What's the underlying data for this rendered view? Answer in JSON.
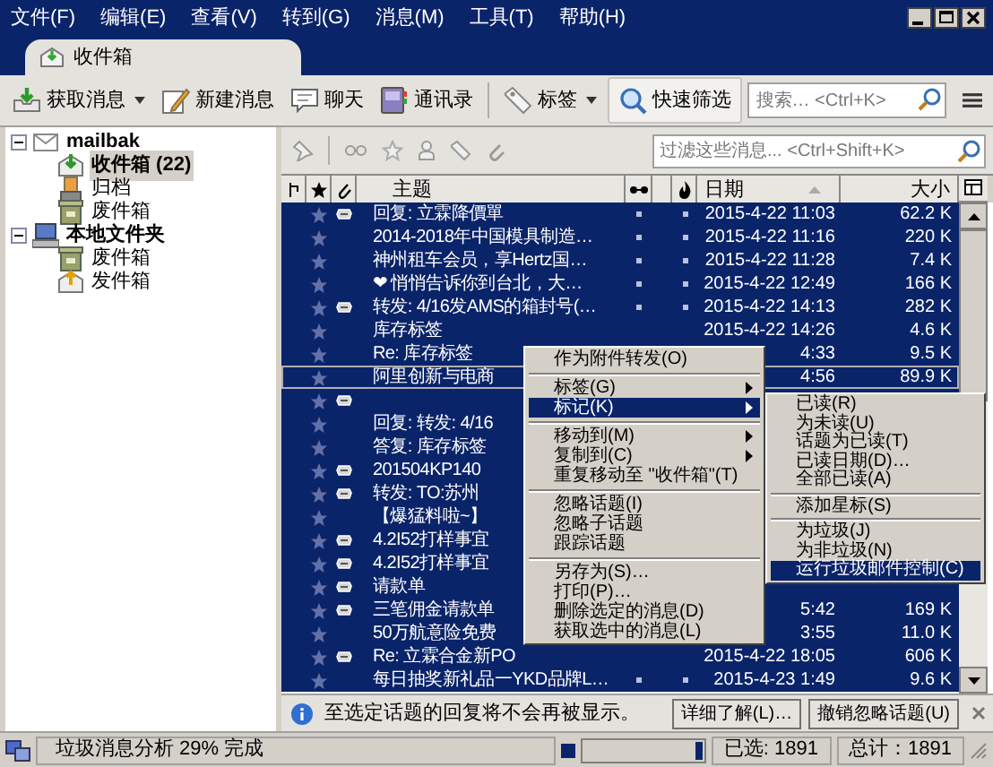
{
  "menu_bar": [
    "文件(F)",
    "编辑(E)",
    "查看(V)",
    "转到(G)",
    "消息(M)",
    "工具(T)",
    "帮助(H)"
  ],
  "tabs": [
    {
      "label": "收件箱",
      "selected": true
    }
  ],
  "toolbar": {
    "buttons": [
      {
        "label": "获取消息",
        "kind": "get",
        "dropdown": true,
        "pressed": false
      },
      {
        "label": "新建消息",
        "kind": "write",
        "dropdown": false,
        "pressed": false
      },
      {
        "label": "聊天",
        "kind": "chat",
        "dropdown": false,
        "pressed": false
      },
      {
        "label": "通讯录",
        "kind": "book",
        "dropdown": false,
        "pressed": false
      },
      {
        "label": "标签",
        "kind": "tag",
        "dropdown": true,
        "pressed": false
      },
      {
        "label": "快速筛选",
        "kind": "filter",
        "dropdown": false,
        "pressed": true
      }
    ],
    "search": {
      "placeholder": "搜索… <Ctrl+K>"
    }
  },
  "folders": [
    {
      "name": "mailbak",
      "kind": "account",
      "expanded": true,
      "selected": false,
      "children": [
        {
          "name": "收件箱",
          "count": "(22)",
          "kind": "inbox",
          "selected": true
        },
        {
          "name": "归档",
          "kind": "archive",
          "selected": false
        },
        {
          "name": "废件箱",
          "kind": "trash",
          "selected": false
        }
      ]
    },
    {
      "name": "本地文件夹",
      "kind": "local",
      "expanded": true,
      "selected": false,
      "children": [
        {
          "name": "废件箱",
          "kind": "trash",
          "selected": false
        },
        {
          "name": "发件箱",
          "kind": "outbox",
          "selected": false
        }
      ]
    }
  ],
  "filter": {
    "placeholder": "过滤这些消息... <Ctrl+Shift+K>"
  },
  "columns": {
    "subject": "主题",
    "date": "日期",
    "size": "大小"
  },
  "messages": [
    {
      "subject": "回复: 立霖降價單",
      "attachment": true,
      "dots": true,
      "date": "2015-4-22 11:03",
      "size": "62.2 K",
      "selected": true,
      "focused": false
    },
    {
      "subject": "2014-2018年中国模具制造…",
      "attachment": false,
      "dots": true,
      "date": "2015-4-22 11:16",
      "size": "220 K",
      "selected": true,
      "focused": false
    },
    {
      "subject": "神州租车会员，享Hertz国…",
      "attachment": false,
      "dots": true,
      "date": "2015-4-22 11:28",
      "size": "7.4 K",
      "selected": true,
      "focused": false
    },
    {
      "subject": "❤ 悄悄告诉你到台北，大…",
      "attachment": false,
      "dots": true,
      "date": "2015-4-22 12:49",
      "size": "166 K",
      "selected": true,
      "focused": false
    },
    {
      "subject": "转发: 4/16发AMS的箱封号(…",
      "attachment": true,
      "dots": true,
      "date": "2015-4-22 14:13",
      "size": "282 K",
      "selected": true,
      "focused": false
    },
    {
      "subject": "库存标签",
      "attachment": false,
      "date": "2015-4-22 14:26",
      "size": "4.6 K",
      "selected": true,
      "focused": false
    },
    {
      "subject": "Re: 库存标签",
      "attachment": false,
      "date": "4:33",
      "size": "9.5 K",
      "selected": true,
      "focused": false
    },
    {
      "subject": "阿里创新与电商",
      "attachment": false,
      "date": "4:56",
      "size": "89.9 K",
      "selected": true,
      "focused": true
    },
    {
      "attachment": true,
      "selected": true,
      "focused": false
    },
    {
      "subject": "回复: 转发: 4/16",
      "attachment": false,
      "selected": true,
      "focused": false
    },
    {
      "subject": "答复: 库存标签",
      "attachment": false,
      "selected": true,
      "focused": false
    },
    {
      "subject": "201504KP140",
      "attachment": true,
      "selected": true,
      "focused": false
    },
    {
      "subject": "转发: TO:苏州",
      "attachment": true,
      "selected": true,
      "focused": false
    },
    {
      "subject": "【爆猛料啦~】",
      "attachment": false,
      "selected": true,
      "focused": false
    },
    {
      "subject": "4.2I52打样事宜",
      "attachment": true,
      "selected": true,
      "focused": false
    },
    {
      "subject": "4.2I52打样事宜",
      "attachment": true,
      "selected": true,
      "focused": false
    },
    {
      "subject": "请款单",
      "attachment": true,
      "selected": true,
      "focused": false
    },
    {
      "subject": "三笔佣金请款单",
      "attachment": true,
      "date": "5:42",
      "size": "169 K",
      "selected": true,
      "focused": false
    },
    {
      "subject": "50万航意险免费",
      "attachment": false,
      "date": "3:55",
      "size": "11.0 K",
      "selected": true,
      "focused": false
    },
    {
      "subject": "Re: 立霖合金新PO",
      "attachment": true,
      "date": "2015-4-22 18:05",
      "size": "606 K",
      "selected": true,
      "focused": false
    },
    {
      "subject": "每日抽奖新礼品一YKD品牌L…",
      "attachment": false,
      "dots": true,
      "date": "2015-4-23 1:49",
      "size": "9.6 K",
      "selected": true,
      "focused": false
    }
  ],
  "context_menu": {
    "items": [
      {
        "kind": "item",
        "label": "作为附件转发(O)",
        "submenu": false,
        "highlighted": false
      },
      {
        "kind": "separator"
      },
      {
        "kind": "item",
        "label": "标签(G)",
        "submenu": true,
        "highlighted": false
      },
      {
        "kind": "item",
        "label": "标记(K)",
        "submenu": true,
        "highlighted": true
      },
      {
        "kind": "separator"
      },
      {
        "kind": "item",
        "label": "移动到(M)",
        "submenu": true,
        "highlighted": false
      },
      {
        "kind": "item",
        "label": "复制到(C)",
        "submenu": true,
        "highlighted": false
      },
      {
        "kind": "item",
        "label": "重复移动至 \"收件箱\"(T)",
        "submenu": false,
        "highlighted": false
      },
      {
        "kind": "separator"
      },
      {
        "kind": "item",
        "label": "忽略话题(I)",
        "submenu": false,
        "highlighted": false
      },
      {
        "kind": "item",
        "label": "忽略子话题",
        "submenu": false,
        "highlighted": false
      },
      {
        "kind": "item",
        "label": "跟踪话题",
        "submenu": false,
        "highlighted": false
      },
      {
        "kind": "separator"
      },
      {
        "kind": "item",
        "label": "另存为(S)…",
        "submenu": false,
        "highlighted": false
      },
      {
        "kind": "item",
        "label": "打印(P)…",
        "submenu": false,
        "highlighted": false
      },
      {
        "kind": "item",
        "label": "删除选定的消息(D)",
        "submenu": false,
        "highlighted": false
      },
      {
        "kind": "item",
        "label": "获取选中的消息(L)",
        "submenu": false,
        "highlighted": false
      }
    ]
  },
  "submenu": {
    "items": [
      {
        "kind": "item",
        "label": "已读(R)",
        "highlighted": false
      },
      {
        "kind": "item",
        "label": "为未读(U)",
        "highlighted": false
      },
      {
        "kind": "item",
        "label": "话题为已读(T)",
        "highlighted": false
      },
      {
        "kind": "item",
        "label": "已读日期(D)…",
        "highlighted": false
      },
      {
        "kind": "item",
        "label": "全部已读(A)",
        "highlighted": false
      },
      {
        "kind": "separator"
      },
      {
        "kind": "item",
        "label": "添加星标(S)",
        "highlighted": false
      },
      {
        "kind": "separator"
      },
      {
        "kind": "item",
        "label": "为垃圾(J)",
        "highlighted": false
      },
      {
        "kind": "item",
        "label": "为非垃圾(N)",
        "highlighted": false
      },
      {
        "kind": "item",
        "label": "运行垃圾邮件控制(C)",
        "highlighted": true
      }
    ]
  },
  "notification": {
    "text": "至选定话题的回复将不会再被显示。",
    "buttons": [
      "详细了解(L)…",
      "撤销忽略话题(U)"
    ]
  },
  "status_bar": {
    "text": "垃圾消息分析 29% 完成",
    "progress": {
      "level": 0.06
    },
    "selected": "已选: 1891",
    "total": "总计：1891"
  }
}
